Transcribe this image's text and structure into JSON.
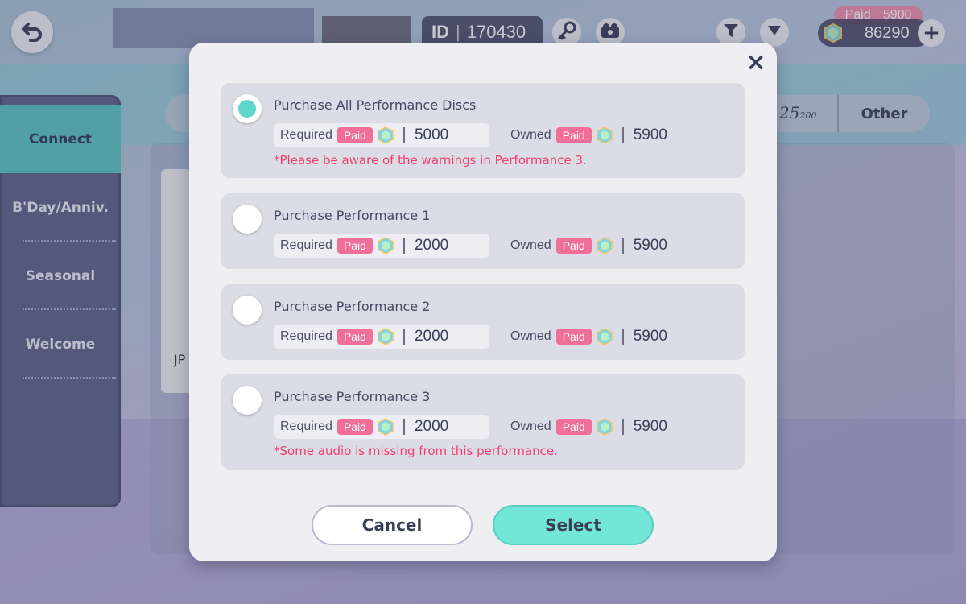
{
  "topbar": {
    "id_label": "ID",
    "id_value": "170430",
    "paid_label": "Paid",
    "paid_amount": "5900",
    "total_amount": "86290",
    "icons": [
      "back-arrow-icon",
      "key-icon",
      "camera-icon",
      "filter-icon",
      "dropdown-icon",
      "gem-icon",
      "plus-icon"
    ]
  },
  "sidebar": {
    "items": [
      {
        "label": "Connect",
        "active": true
      },
      {
        "label": "B'Day/Anniv.",
        "active": false
      },
      {
        "label": "Seasonal",
        "active": false
      },
      {
        "label": "Welcome",
        "active": false
      }
    ]
  },
  "tabs": {
    "other_label": "Other",
    "fraction_text": "25",
    "fraction_denominator": "200"
  },
  "background_card": {
    "text": "JP"
  },
  "modal": {
    "close_icon": "×",
    "options": [
      {
        "title": "Purchase All Performance Discs",
        "selected": true,
        "required_label": "Required",
        "required_tag": "Paid",
        "required_value": "5000",
        "owned_label": "Owned",
        "owned_tag": "Paid",
        "owned_value": "5900",
        "warning": "*Please be aware of the warnings in Performance 3."
      },
      {
        "title": "Purchase Performance 1",
        "selected": false,
        "required_label": "Required",
        "required_tag": "Paid",
        "required_value": "2000",
        "owned_label": "Owned",
        "owned_tag": "Paid",
        "owned_value": "5900",
        "warning": ""
      },
      {
        "title": "Purchase Performance 2",
        "selected": false,
        "required_label": "Required",
        "required_tag": "Paid",
        "required_value": "2000",
        "owned_label": "Owned",
        "owned_tag": "Paid",
        "owned_value": "5900",
        "warning": ""
      },
      {
        "title": "Purchase Performance 3",
        "selected": false,
        "required_label": "Required",
        "required_tag": "Paid",
        "required_value": "2000",
        "owned_label": "Owned",
        "owned_tag": "Paid",
        "owned_value": "5900",
        "warning": "*Some audio is missing from this performance."
      }
    ],
    "cancel_label": "Cancel",
    "select_label": "Select"
  },
  "colors": {
    "accent_teal": "#72e6d8",
    "paid_pink": "#ef6f99",
    "warning_red": "#ef3f6c",
    "sidebar_bg": "#5d6589"
  }
}
